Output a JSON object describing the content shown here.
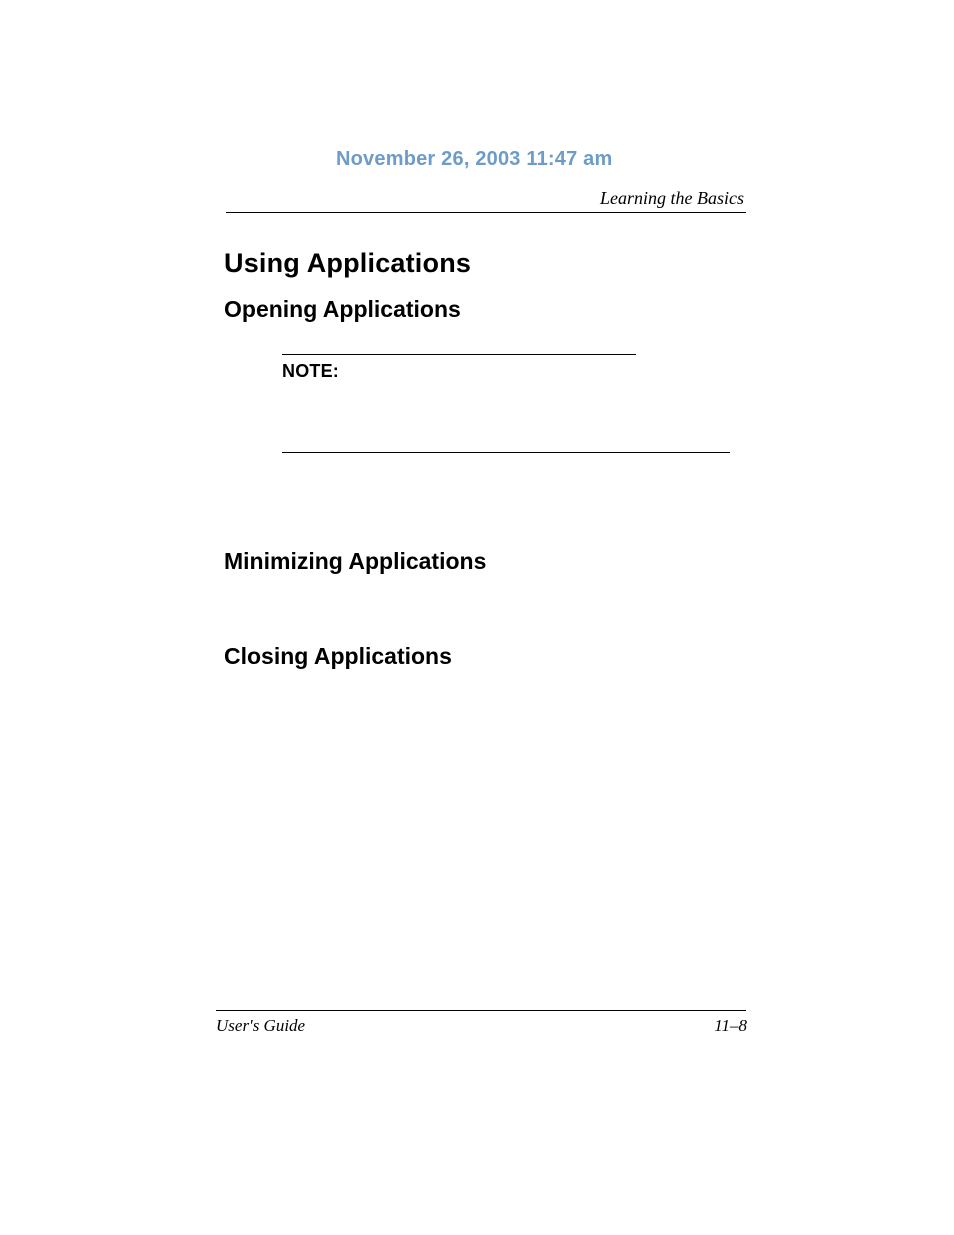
{
  "header": {
    "timestamp": "November 26, 2003 11:47 am",
    "chapter": "Learning the Basics"
  },
  "headings": {
    "h1": "Using Applications",
    "h2a": "Opening Applications",
    "h2b": "Minimizing Applications",
    "h2c": "Closing Applications"
  },
  "note": {
    "label": "NOTE:"
  },
  "footer": {
    "left": "User's Guide",
    "right": "11–8"
  }
}
